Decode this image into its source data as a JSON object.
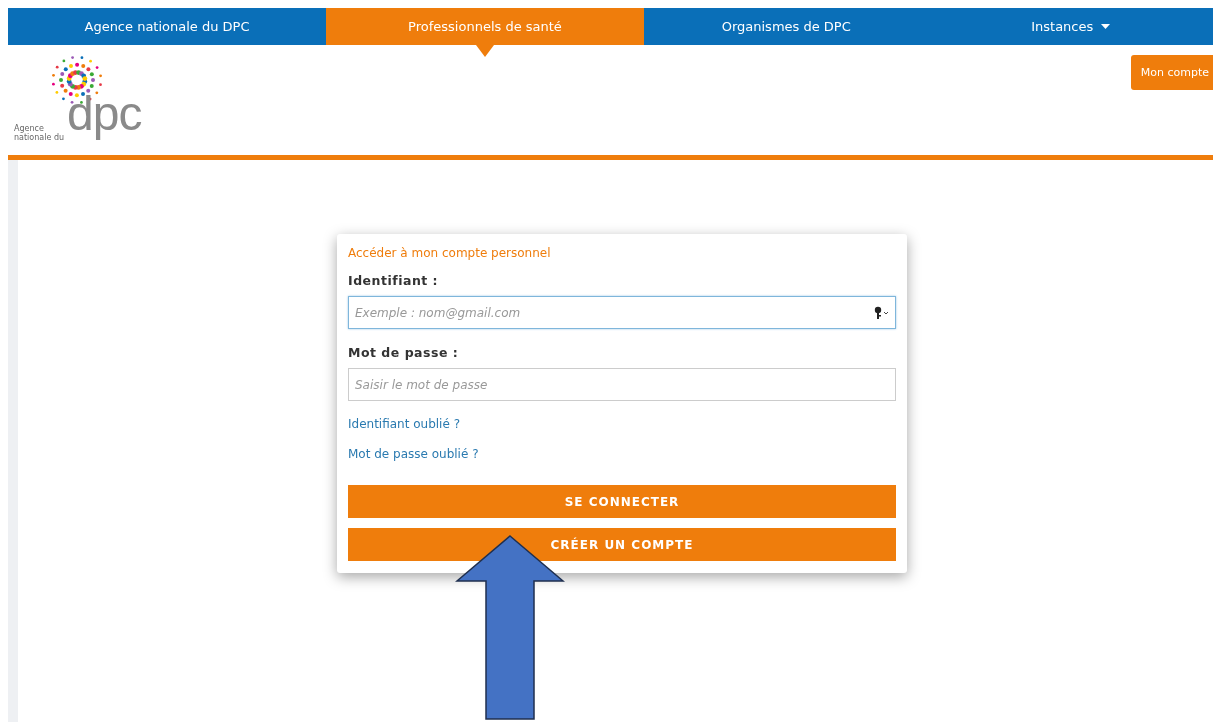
{
  "nav": {
    "tabs": [
      {
        "label": "Agence nationale du DPC",
        "selected": false,
        "dropdown": false
      },
      {
        "label": "Professionnels de santé",
        "selected": true,
        "dropdown": false
      },
      {
        "label": "Organismes de DPC",
        "selected": false,
        "dropdown": false
      },
      {
        "label": "Instances",
        "selected": false,
        "dropdown": true
      }
    ]
  },
  "header": {
    "logo": {
      "mark": "dpc",
      "caption_1": "Agence",
      "caption_2": "nationale du"
    },
    "account_button": "Mon compte"
  },
  "login": {
    "title": "Accéder à mon compte personnel",
    "fields": [
      {
        "label": "Identifiant :",
        "placeholder": "Exemple : nom@gmail.com",
        "focused": true,
        "kind": "text"
      },
      {
        "label": "Mot de passe :",
        "placeholder": "Saisir le mot de passe",
        "focused": false,
        "kind": "password"
      }
    ],
    "links": [
      "Identifiant oublié ?",
      "Mot de passe oublié ?"
    ],
    "buttons": [
      "SE CONNECTER",
      "CRÉER UN COMPTE"
    ]
  },
  "annotation": {
    "kind": "arrow"
  }
}
